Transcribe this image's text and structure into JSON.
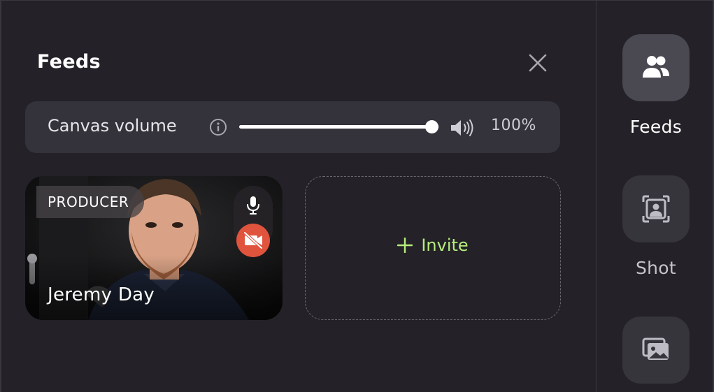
{
  "panel": {
    "title": "Feeds",
    "close_icon": "close-icon"
  },
  "volume": {
    "label": "Canvas volume",
    "info_icon": "info-icon",
    "level": 1.0,
    "percent_text": "100%",
    "speaker_icon": "speaker-icon"
  },
  "feed": {
    "role": "PRODUCER",
    "name": "Jeremy Day",
    "mic_icon": "microphone-icon",
    "camera_off_icon": "camera-off-icon",
    "camera_off_color": "#e0533d"
  },
  "invite": {
    "label": "Invite",
    "icon": "plus-icon",
    "accent": "#b6ec7c"
  },
  "rail": {
    "items": [
      {
        "label": "Feeds",
        "icon": "people-icon",
        "active": true
      },
      {
        "label": "Shot",
        "icon": "shot-icon",
        "active": false
      },
      {
        "label": "",
        "icon": "images-icon",
        "active": false
      }
    ]
  }
}
